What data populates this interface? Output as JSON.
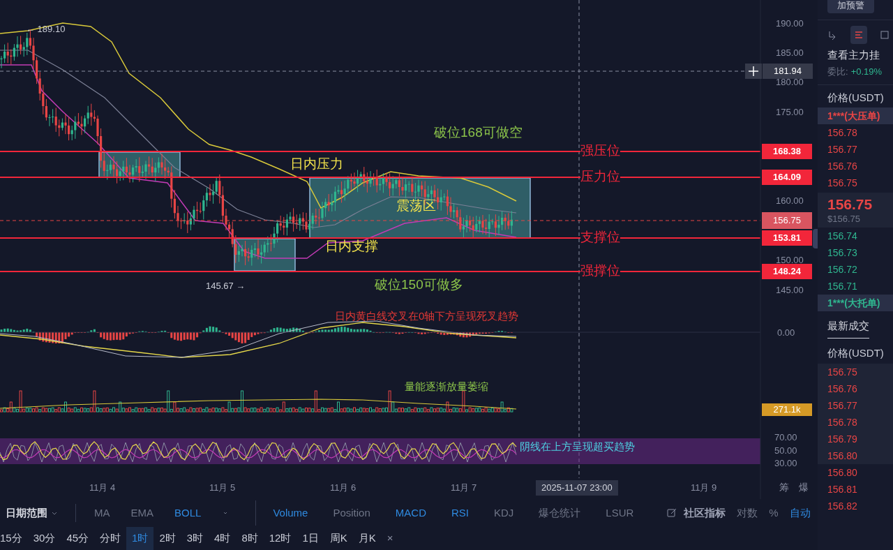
{
  "chart": {
    "high_marker": "← 189.10",
    "low_marker": "145.67 →",
    "price_axis": [
      "190.00",
      "185.00",
      "180.00",
      "175.00",
      "160.00",
      "150.00",
      "145.00"
    ],
    "crosshair_price": "181.94",
    "current_price": "156.75",
    "level_lines": [
      {
        "price": "168.38",
        "label": "强压位"
      },
      {
        "price": "164.09",
        "label": "压力位"
      },
      {
        "price": "153.81",
        "label": "支撑位"
      },
      {
        "price": "148.24",
        "label": "强撑位"
      }
    ],
    "annotations": [
      {
        "text": "破位168可做空",
        "color": "#8bc34a"
      },
      {
        "text": "日内压力",
        "color": "#f2e24b"
      },
      {
        "text": "震荡区",
        "color": "#f2e24b"
      },
      {
        "text": "日内支撑",
        "color": "#f2e24b"
      },
      {
        "text": "破位150可做多",
        "color": "#8bc34a"
      }
    ],
    "x_axis": [
      "11月 4",
      "11月 5",
      "11月 6",
      "11月 7",
      "11月 9"
    ],
    "crosshair_time": "2025-11-07 23:00",
    "side_buttons": [
      "筹",
      "爆"
    ]
  },
  "macd": {
    "zero_label": "0.00",
    "note": "日内黄白线交叉在0轴下方呈现死叉趋势"
  },
  "volume": {
    "label": "271.1k",
    "note": "量能逐渐放量萎缩"
  },
  "rsi": {
    "levels": [
      "70.00",
      "50.00",
      "30.00"
    ],
    "note": "阴线在上方呈现超买趋势"
  },
  "indicator_bar": {
    "date_range": "日期范围",
    "main_indicators": [
      {
        "label": "MA",
        "active": false
      },
      {
        "label": "EMA",
        "active": false
      },
      {
        "label": "BOLL",
        "active": true
      }
    ],
    "sub_indicators": [
      {
        "label": "Volume",
        "active": true
      },
      {
        "label": "Position",
        "active": false
      },
      {
        "label": "MACD",
        "active": true
      },
      {
        "label": "RSI",
        "active": true
      },
      {
        "label": "KDJ",
        "active": false
      },
      {
        "label": "爆仓统计",
        "active": false
      },
      {
        "label": "LSUR",
        "active": false
      }
    ],
    "community": "社区指标",
    "options": [
      {
        "label": "对数",
        "active": false
      },
      {
        "label": "%",
        "active": false
      },
      {
        "label": "自动",
        "active": true
      }
    ]
  },
  "intervals": [
    {
      "label": "15分",
      "selected": false
    },
    {
      "label": "30分",
      "selected": false
    },
    {
      "label": "45分",
      "selected": false
    },
    {
      "label": "分时",
      "selected": false
    },
    {
      "label": "1时",
      "selected": true
    },
    {
      "label": "2时",
      "selected": false
    },
    {
      "label": "3时",
      "selected": false
    },
    {
      "label": "4时",
      "selected": false
    },
    {
      "label": "8时",
      "selected": false
    },
    {
      "label": "12时",
      "selected": false
    },
    {
      "label": "1日",
      "selected": false
    },
    {
      "label": "周K",
      "selected": false
    },
    {
      "label": "月K",
      "selected": false
    }
  ],
  "intervals_close": "×",
  "order_book": {
    "alert_button": "加预警",
    "view_tabs": [
      {
        "selected": false
      },
      {
        "selected": true
      },
      {
        "selected": false
      }
    ],
    "title": "查看主力挂",
    "ratio_label": "委比:",
    "ratio_value": "+0.19%",
    "price_header": "价格(USDT)",
    "big_ask": "1***(大压单)",
    "asks": [
      "156.78",
      "156.77",
      "156.76",
      "156.75"
    ],
    "last_price": "156.75",
    "last_price_usd": "$156.75",
    "bids": [
      "156.74",
      "156.73",
      "156.72",
      "156.71"
    ],
    "big_bid": "1***(大托单)",
    "trades_tab": "最新成交",
    "trades_header": "价格(USDT)",
    "trades": [
      "156.75",
      "156.76",
      "156.77",
      "156.78",
      "156.79",
      "156.80",
      "156.80",
      "156.81",
      "156.82"
    ]
  }
}
